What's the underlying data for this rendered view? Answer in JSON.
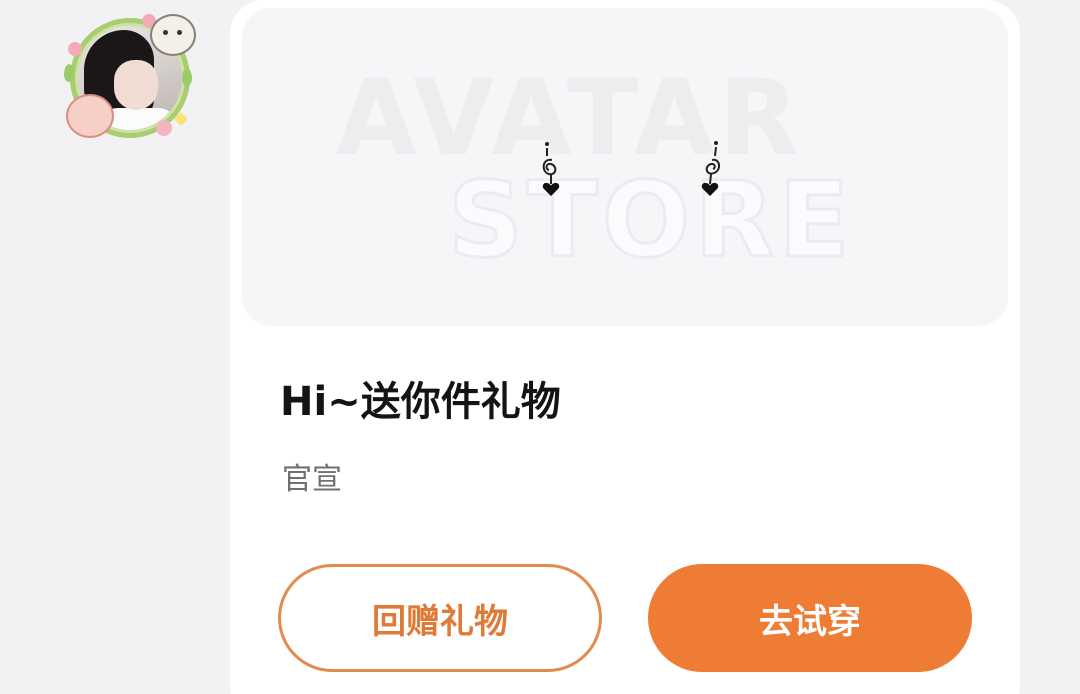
{
  "gift_card": {
    "watermark_line1": "AVATAR",
    "watermark_line2": "STORE",
    "title": "Hi~送你件礼物",
    "subtitle": "官宣",
    "return_gift_label": "回赠礼物",
    "try_on_label": "去试穿"
  },
  "colors": {
    "accent": "#ee7c35",
    "outline_text": "#e07a37",
    "title_text": "#141414",
    "subtitle_text": "#707070",
    "page_background": "#f2f2f4",
    "card_background": "#ffffff"
  },
  "icons": {
    "avatar": "user-avatar-with-cat-frame",
    "item": "heart-earrings"
  }
}
